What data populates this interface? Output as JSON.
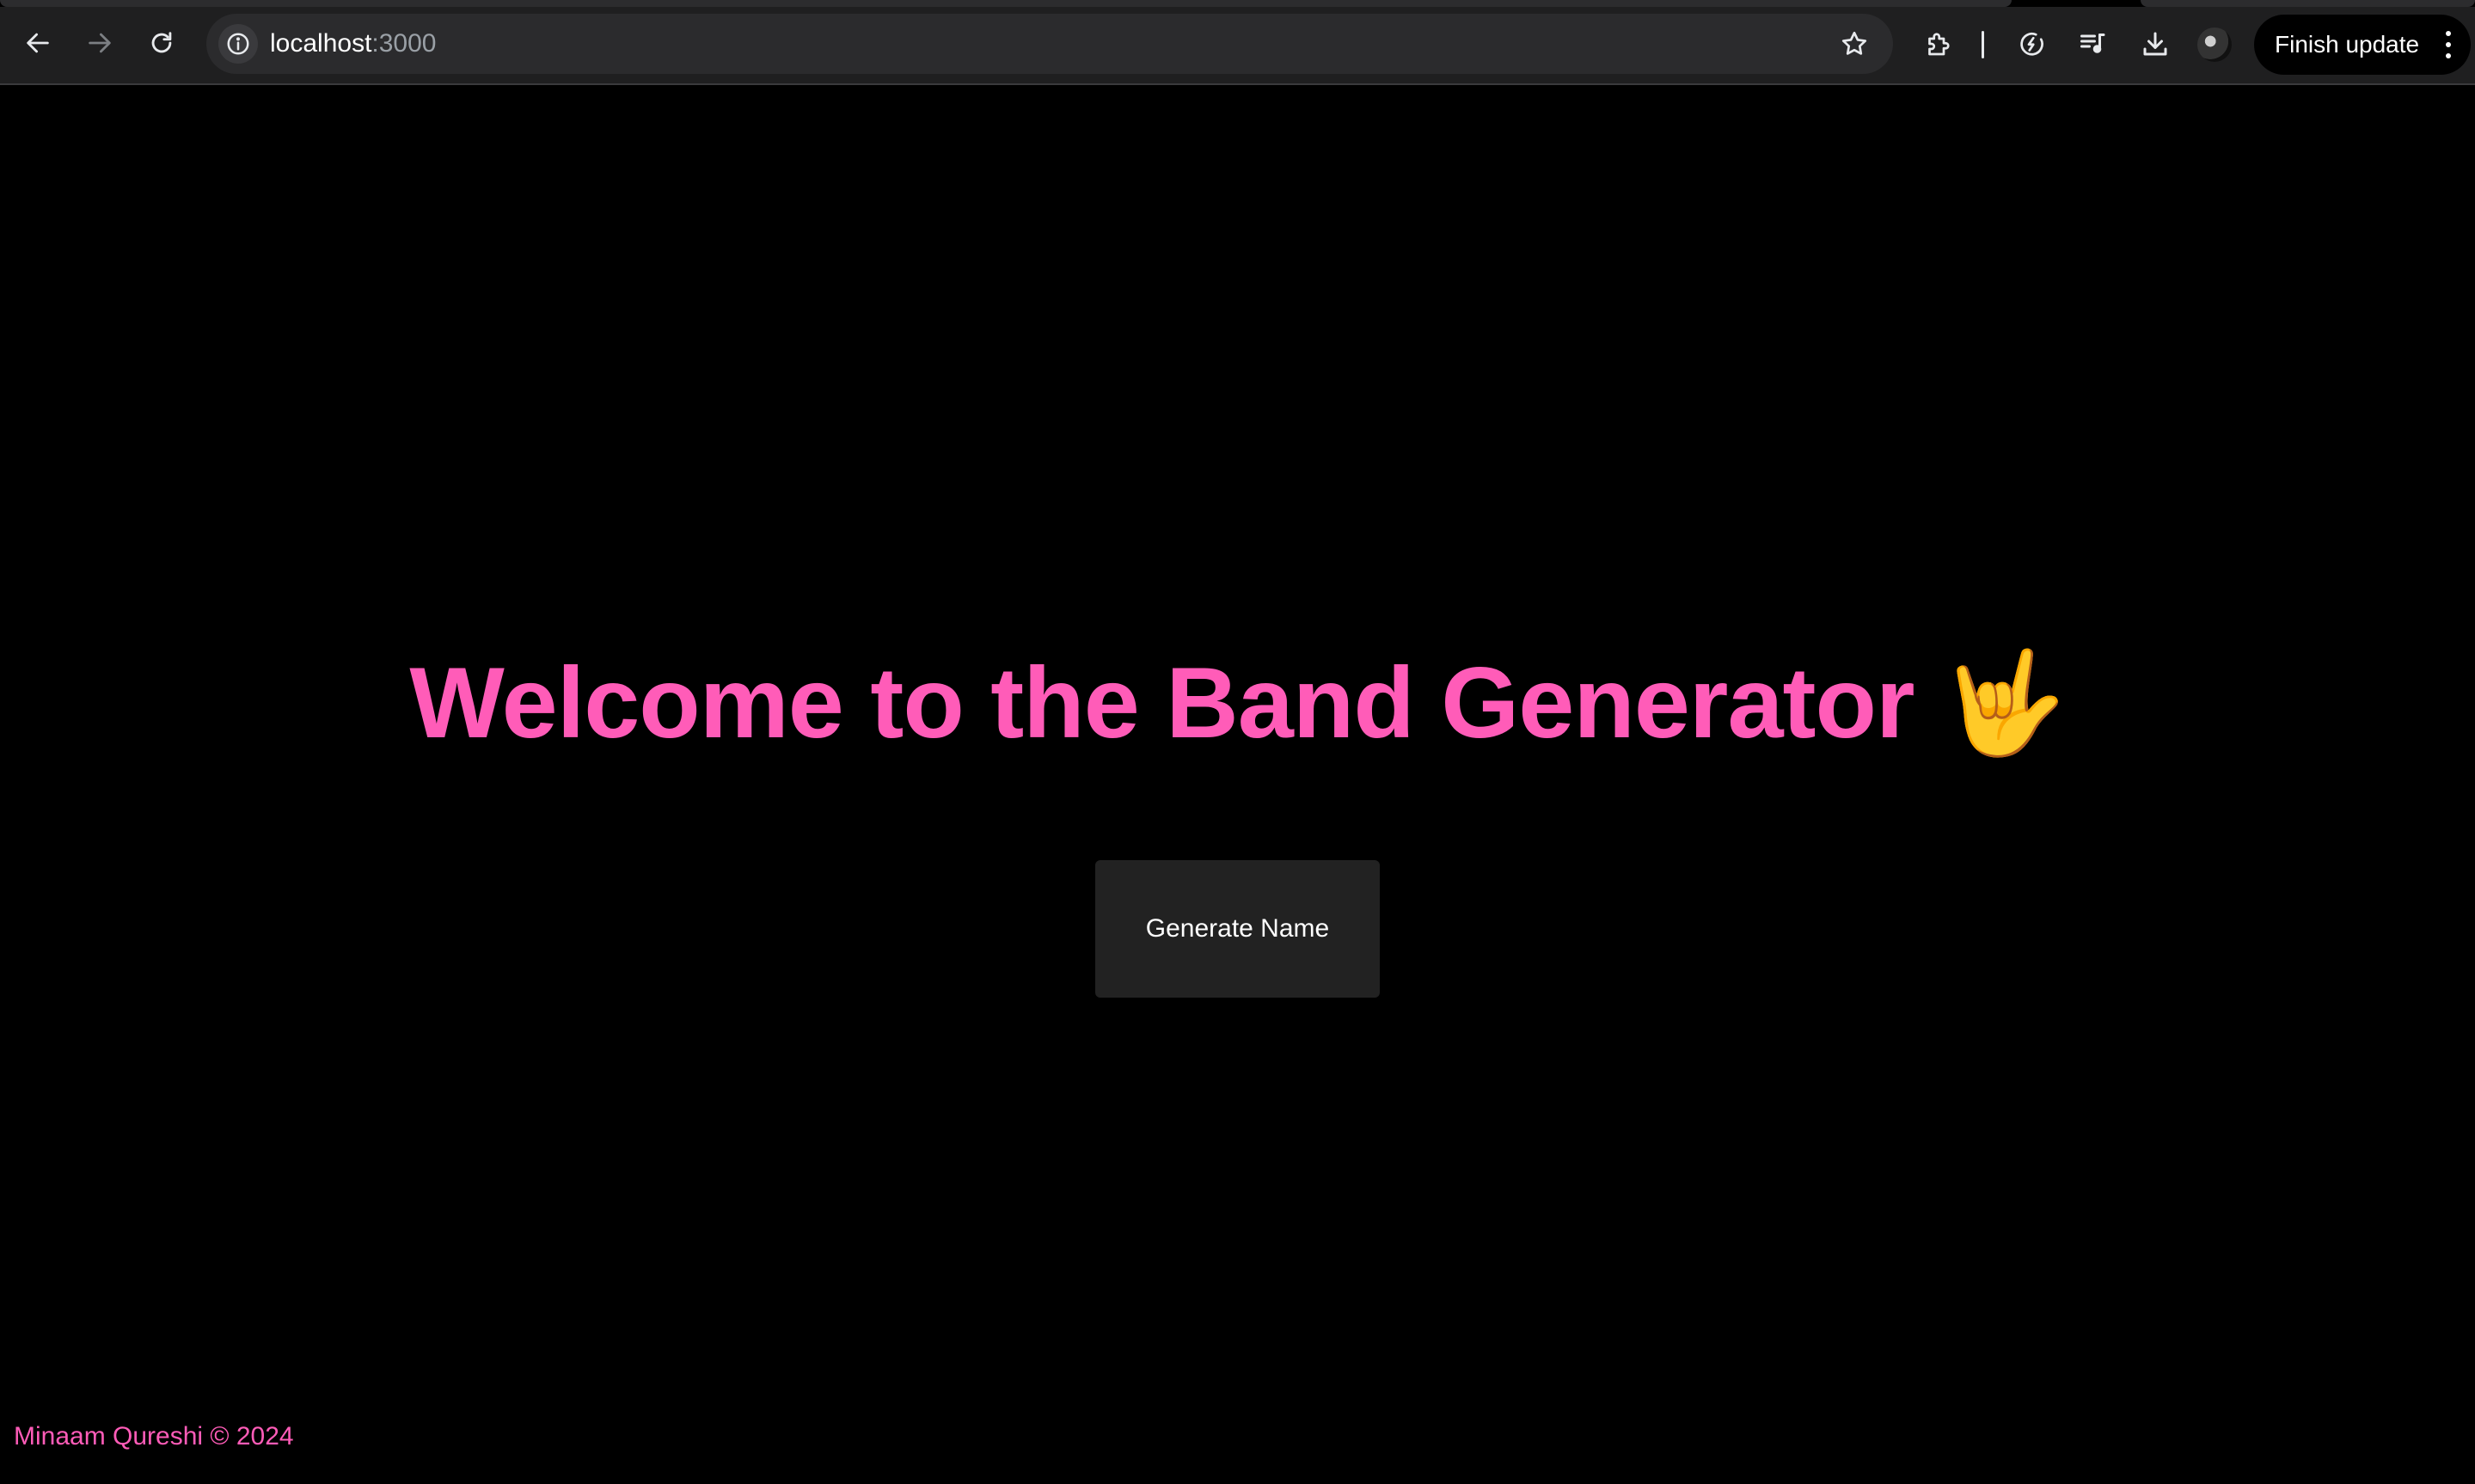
{
  "browser": {
    "url_host": "localhost",
    "url_port": ":3000",
    "update_button_label": "Finish update",
    "icons": {
      "back": "arrow-left-icon",
      "forward": "arrow-right-icon",
      "reload": "reload-icon",
      "site_info": "info-icon",
      "bookmark": "star-icon",
      "extensions": "puzzle-icon",
      "performance": "speedometer-icon",
      "media": "music-queue-icon",
      "downloads": "download-icon",
      "profile": "avatar",
      "menu": "kebab-menu-icon"
    }
  },
  "page": {
    "heading": "Welcome to the Band Generator",
    "heading_emoji": "🤟",
    "generate_button_label": "Generate Name",
    "footer_text": "Minaam Qureshi © 2024"
  },
  "colors": {
    "accent_pink": "#ff5cb8",
    "page_background": "#000000",
    "button_background": "#222222",
    "toolbar_background": "#1f1f20"
  }
}
